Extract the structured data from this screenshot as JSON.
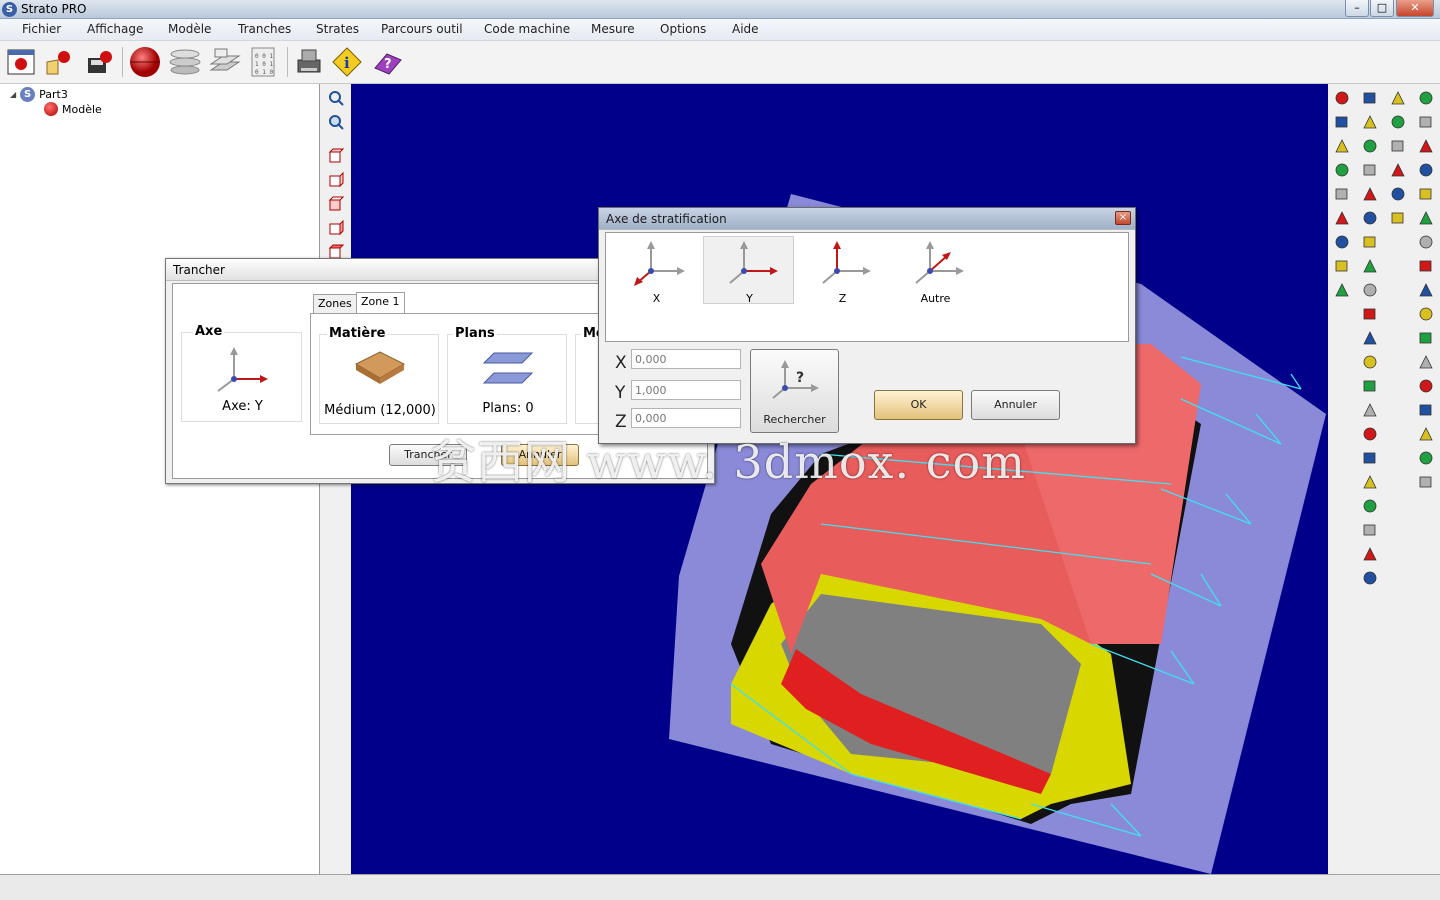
{
  "app": {
    "title": "Strato PRO"
  },
  "window_controls": {
    "minimize": "–",
    "maximize": "□",
    "close": "✕"
  },
  "menu": [
    "Fichier",
    "Affichage",
    "Modèle",
    "Tranches",
    "Strates",
    "Parcours outil",
    "Code machine",
    "Mesure",
    "Options",
    "Aide"
  ],
  "tree": {
    "root": "Part3",
    "child": "Modèle"
  },
  "trancher": {
    "title": "Trancher",
    "tabs": [
      "Zones",
      "Zone 1"
    ],
    "axe_title": "Axe",
    "axe_value": "Axe: Y",
    "matiere_title": "Matière",
    "matiere_value": "Médium (12,000)",
    "plans_title": "Plans",
    "plans_value": "Plans: 0",
    "cut_title": "Mo",
    "btn_trancher": "Trancher",
    "btn_annuler": "Annuler"
  },
  "axe_dialog": {
    "title": "Axe de stratification",
    "close": "×",
    "options": [
      "X",
      "Y",
      "Z",
      "Autre"
    ],
    "selected": "Y",
    "coords": [
      {
        "label": "X",
        "value": "0,000"
      },
      {
        "label": "Y",
        "value": "1,000"
      },
      {
        "label": "Z",
        "value": "0,000"
      }
    ],
    "rechercher": "Rechercher",
    "ok": "OK",
    "annuler": "Annuler"
  },
  "watermark": "贫西网 www. 3dmox. com",
  "colors": {
    "viewport_bg": "#00008b",
    "model_red": "#e85050",
    "model_yellow": "#d8d800",
    "plane": "#8a8ad8"
  }
}
